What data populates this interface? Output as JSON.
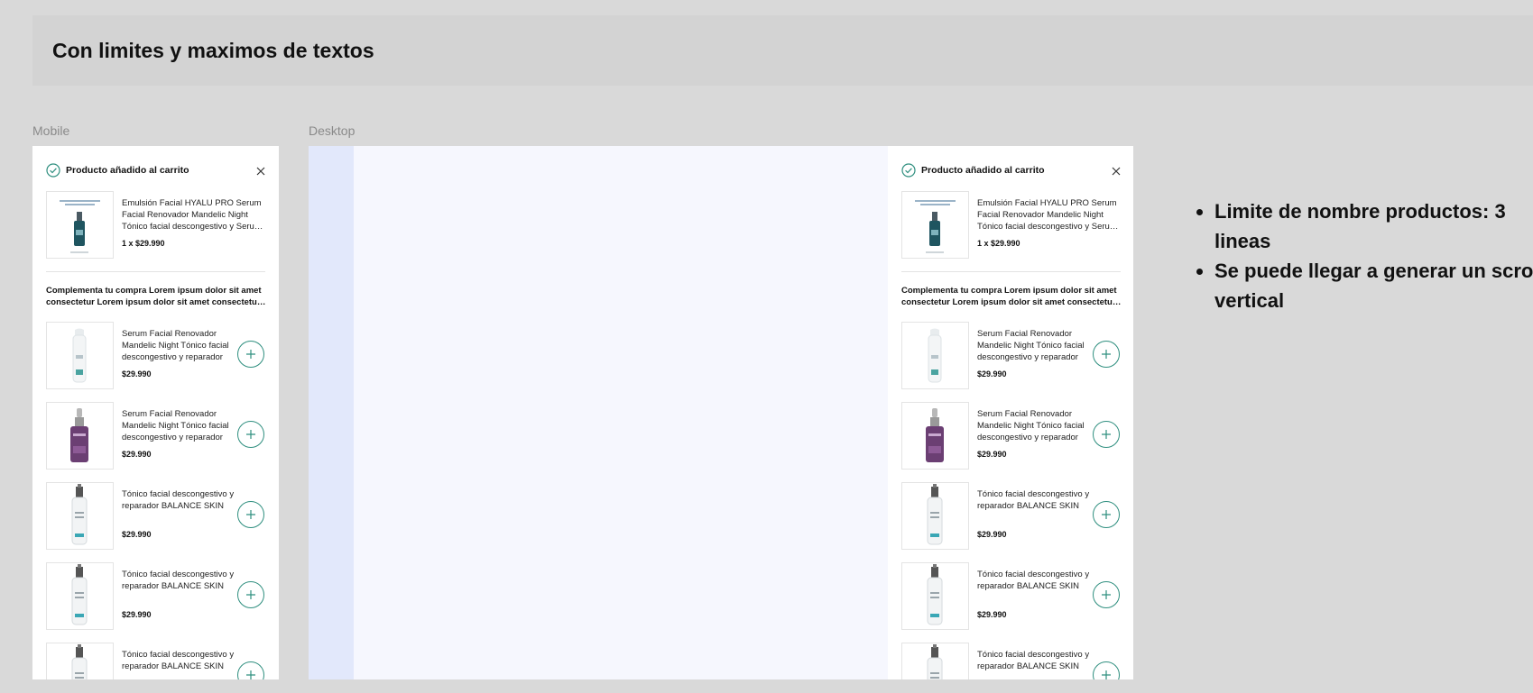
{
  "banner": {
    "title": "Con limites y maximos de textos"
  },
  "frames": {
    "mobile_label": "Mobile",
    "desktop_label": "Desktop"
  },
  "panel": {
    "title": "Producto añadido al carrito",
    "added_product": {
      "name": "Emulsión Facial HYALU PRO Serum Facial Renovador Mandelic Night Tónico facial descongestivo y Serum Facial Renovador",
      "qty_price": "1 x $29.990",
      "thumb_text_top": "EMULSIÓN FACIAL HYALU PRO",
      "thumb_text_bottom": "HYALU PRO"
    },
    "complement_text": "Complementa tu compra Lorem ipsum dolor sit amet consectetur Lorem ipsum dolor sit amet consectetur adipiscing elit",
    "recommendations": [
      {
        "name": "Serum Facial Renovador Mandelic Night Tónico facial descongestivo y reparador",
        "price": "$29.990",
        "image": "white-serum-bottle"
      },
      {
        "name": "Serum Facial Renovador Mandelic Night Tónico facial descongestivo y reparador",
        "price": "$29.990",
        "image": "purple-dropper-bottle"
      },
      {
        "name": "Tónico facial descongestivo y reparador BALANCE SKIN",
        "price": "$29.990",
        "image": "spray-bottle"
      },
      {
        "name": "Tónico facial descongestivo y reparador BALANCE SKIN",
        "price": "$29.990",
        "image": "spray-bottle"
      },
      {
        "name": "Tónico facial descongestivo y reparador BALANCE SKIN",
        "price": "",
        "image": "spray-bottle"
      }
    ]
  },
  "notes": [
    "Limite de nombre productos: 3 lineas",
    "Se puede llegar a generar un scroll vertical"
  ],
  "colors": {
    "accent": "#2f8f7f",
    "background": "#d9d9d9",
    "banner": "#d3d3d3",
    "desktop_overlay": "#f6f7fe"
  }
}
